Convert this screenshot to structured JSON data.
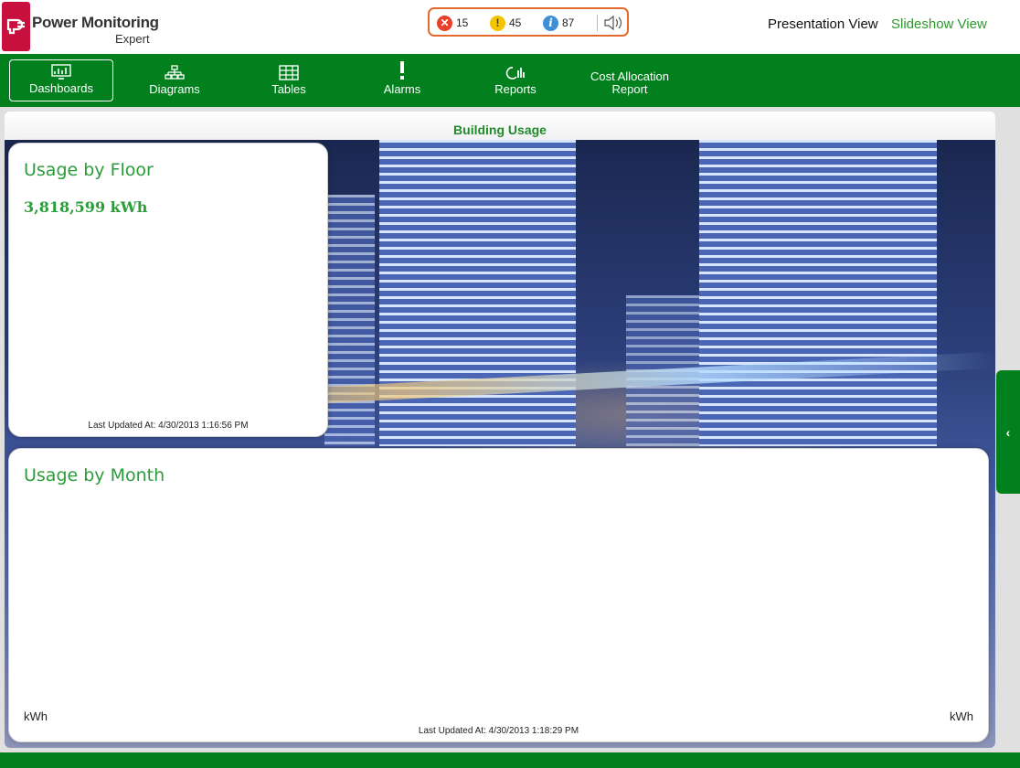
{
  "header": {
    "app_name_line1": "Power Monitoring",
    "app_name_line2": "Expert",
    "alarms": {
      "error_count": "15",
      "warning_count": "45",
      "info_count": "87"
    },
    "presentation_view": "Presentation View",
    "slideshow_view": "Slideshow View"
  },
  "nav": {
    "items": [
      {
        "label": "Dashboards",
        "icon": "dashboard-icon"
      },
      {
        "label": "Diagrams",
        "icon": "diagram-icon"
      },
      {
        "label": "Tables",
        "icon": "table-icon"
      },
      {
        "label": "Alarms",
        "icon": "alarm-icon"
      },
      {
        "label": "Reports",
        "icon": "report-icon"
      },
      {
        "label": "Cost Allocation",
        "label2": "Report"
      }
    ]
  },
  "dashboard": {
    "title": "Building Usage",
    "floor": {
      "title": "Usage by Floor",
      "value": "3,818,599 kWh",
      "updated": "Last Updated At: 4/30/2013 1:16:56 PM"
    },
    "month": {
      "title": "Usage by Month",
      "left_unit": "kWh",
      "right_unit": "kWh",
      "updated": "Last Updated At: 4/30/2013 1:18:29 PM"
    }
  },
  "side_tab": {
    "glyph": "‹"
  },
  "colors": {
    "brand_green": "#02801d",
    "logo_red": "#c8103e",
    "accent_text": "#2a9d3a"
  }
}
